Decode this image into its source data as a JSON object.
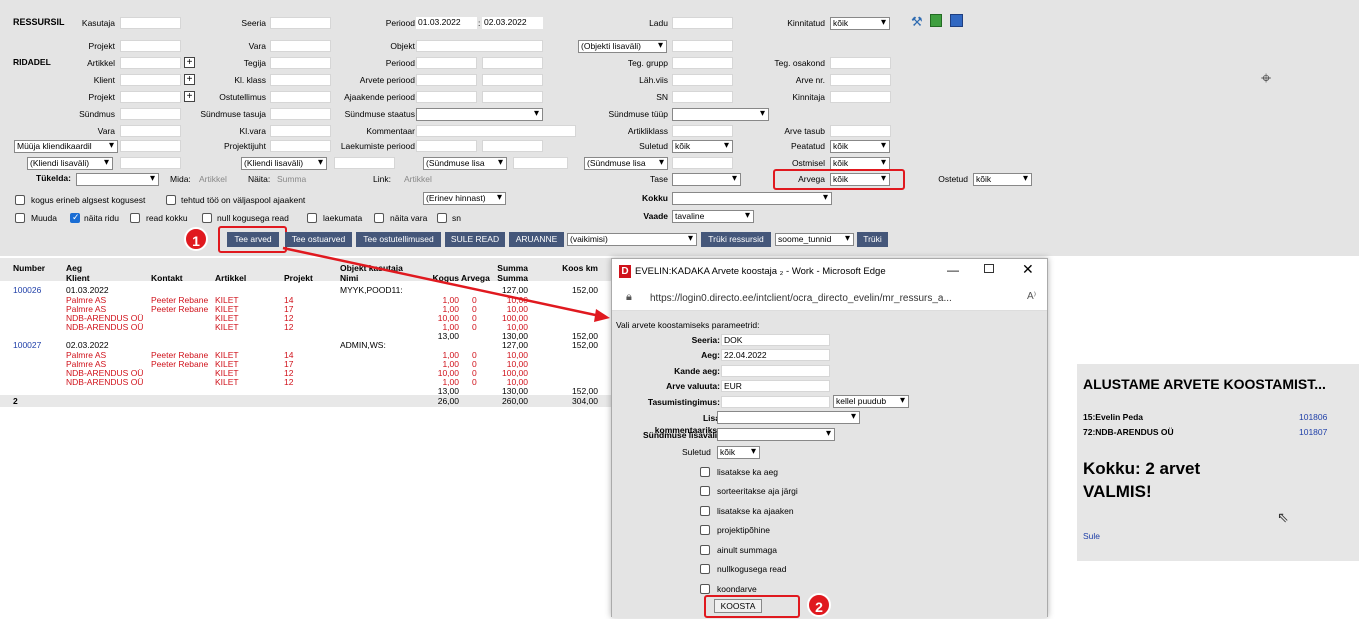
{
  "form": {
    "title": "RESSURSIL",
    "ridadel": "RIDADEL",
    "kasutaja": "Kasutaja",
    "seeria": "Seeria",
    "periood": "Periood",
    "period_from": "01.03.2022",
    "period_sep": ":",
    "period_to": "02.03.2022",
    "ladu": "Ladu",
    "kinnitatud": "Kinnitatud",
    "kinnitatud_val": "kõik",
    "projekt": "Projekt",
    "vara": "Vara",
    "objekt": "Objekt",
    "objekti_lisavali": "(Objekti lisaväli)",
    "artikkel": "Artikkel",
    "tegija": "Tegija",
    "teg_grupp": "Teg. grupp",
    "teg_osakond": "Teg. osakond",
    "klient": "Klient",
    "kl_klass": "Kl. klass",
    "arvete_periood": "Arvete periood",
    "lah_viis": "Läh.viis",
    "arve_nr": "Arve nr.",
    "ostutellimus": "Ostutellimus",
    "ajaakende_periood": "Ajaakende periood",
    "sn": "SN",
    "kinnitaja": "Kinnitaja",
    "syndmus": "Sündmus",
    "syndmuse_tasuja": "Sündmuse tasuja",
    "syndmuse_staatus": "Sündmuse staatus",
    "syndmuse_tyyp": "Sündmuse tüüp",
    "kl_vara": "Kl.vara",
    "kommentaar": "Kommentaar",
    "artikliklass": "Artikliklass",
    "arve_tasub": "Arve tasub",
    "myyja_kliendikaardil": "Müüja kliendikaardil",
    "projektijuht": "Projektijuht",
    "laekumiste_periood": "Laekumiste periood",
    "suletud": "Suletud",
    "suletud_val": "kõik",
    "peatatud": "Peatatud",
    "peatatud_val": "kõik",
    "kliendi_lisavali": "(Kliendi lisaväli)",
    "kliendi_lisavali2": "(Kliendi lisaväli)",
    "syndmuse_lisa": "(Sündmuse lisa",
    "syndmuse_lisa2": "(Sündmuse lisa",
    "ostmisel": "Ostmisel",
    "ostmisel_val": "kõik",
    "tykelda": "Tükelda:",
    "mida": "Mida:",
    "mida_val": "Artikkel",
    "naita": "Näita:",
    "naita_val": "Summa",
    "link": "Link:",
    "link_val": "Artikkel",
    "tase": "Tase",
    "arvega": "Arvega",
    "arvega_val": "kõik",
    "ostetud": "Ostetud",
    "ostetud_val": "kõik",
    "erinev_hinnast": "(Erinev hinnast)",
    "kokku": "Kokku",
    "vaade": "Vaade",
    "vaade_val": "tavaline",
    "cb1": "kogus erineb algsest kogusest",
    "cb2": "tehtud töö on väljaspool ajaakent",
    "cb3": "Muuda",
    "cb4": "näita ridu",
    "cb5": "read kokku",
    "cb6": "null kogusega read",
    "cb7": "laekumata",
    "cb8": "näita vara",
    "cb9": "sn"
  },
  "buttons": {
    "tee_arved": "Tee arved",
    "tee_ostuarved": "Tee ostuarved",
    "tee_ostutellimused": "Tee ostutellimused",
    "sule_read": "SULE READ",
    "aruanne": "ARUANNE",
    "vaikimisi": "(vaikimisi)",
    "tryki_ressursid": "Trüki ressursid",
    "soome_tunnid": "soome_tunnid",
    "tryki": "Trüki"
  },
  "badges": {
    "one": "1",
    "two": "2"
  },
  "table": {
    "headers": {
      "number": "Number",
      "aeg": "Aeg",
      "klient": "Klient",
      "kontakt": "Kontakt",
      "artikkel": "Artikkel",
      "projekt": "Projekt",
      "objekt_kasutaja": "Objekt kasutaja",
      "nimi": "Nimi",
      "kogus": "Kogus",
      "arvega": "Arvega",
      "summa": "Summa",
      "summa2": "Summa",
      "koos_km": "Koos km"
    },
    "groups": [
      {
        "number": "100026",
        "date": "01.03.2022",
        "obj": "MYYK,POOD11:",
        "sum": "127,00",
        "km": "152,00",
        "rows": [
          {
            "klient": "Palmre AS",
            "kontakt": "Peeter Rebane",
            "art": "KILET",
            "proj": "14",
            "kogus": "1,00",
            "arvega": "0",
            "summa": "10,00"
          },
          {
            "klient": "Palmre AS",
            "kontakt": "Peeter Rebane",
            "art": "KILET",
            "proj": "17",
            "kogus": "1,00",
            "arvega": "0",
            "summa": "10,00"
          },
          {
            "klient": "NDB-ARENDUS OÜ",
            "kontakt": "",
            "art": "KILET",
            "proj": "12",
            "kogus": "10,00",
            "arvega": "0",
            "summa": "100,00"
          },
          {
            "klient": "NDB-ARENDUS OÜ",
            "kontakt": "",
            "art": "KILET",
            "proj": "12",
            "kogus": "1,00",
            "arvega": "0",
            "summa": "10,00"
          }
        ],
        "tot_kogus": "13,00",
        "tot_sum": "130,00",
        "tot_km": "152,00"
      },
      {
        "number": "100027",
        "date": "02.03.2022",
        "obj": "ADMIN,WS:",
        "sum": "127,00",
        "km": "152,00",
        "rows": [
          {
            "klient": "Palmre AS",
            "kontakt": "Peeter Rebane",
            "art": "KILET",
            "proj": "14",
            "kogus": "1,00",
            "arvega": "0",
            "summa": "10,00"
          },
          {
            "klient": "Palmre AS",
            "kontakt": "Peeter Rebane",
            "art": "KILET",
            "proj": "17",
            "kogus": "1,00",
            "arvega": "0",
            "summa": "10,00"
          },
          {
            "klient": "NDB-ARENDUS OÜ",
            "kontakt": "",
            "art": "KILET",
            "proj": "12",
            "kogus": "10,00",
            "arvega": "0",
            "summa": "100,00"
          },
          {
            "klient": "NDB-ARENDUS OÜ",
            "kontakt": "",
            "art": "KILET",
            "proj": "12",
            "kogus": "1,00",
            "arvega": "0",
            "summa": "10,00"
          }
        ],
        "tot_kogus": "13,00",
        "tot_sum": "130,00",
        "tot_km": "152,00"
      }
    ],
    "grand": {
      "count": "2",
      "kogus": "26,00",
      "sum": "260,00",
      "km": "304,00"
    }
  },
  "dialog": {
    "title": "EVELIN:KADAKA Arvete koostaja ₂ - Work - Microsoft Edge",
    "url": "https://login0.directo.ee/intclient/ocra_directo_evelin/mr_ressurs_a...",
    "intro": "Vali arvete koostamiseks parameetrid:",
    "seeria": "Seeria:",
    "seeria_val": "DOK",
    "aeg": "Aeg:",
    "aeg_val": "22.04.2022",
    "kande_aeg": "Kande aeg:",
    "valuuta": "Arve valuuta:",
    "valuuta_val": "EUR",
    "tasumistingimus": "Tasumistingimus:",
    "kellel_puudub": "kellel puudub",
    "lisa_kommentaariks": "Lisa kommentaariks:",
    "syndmuse_lisavali": "Sündmuse lisaväli:",
    "suletud": "Suletud",
    "suletud_val": "kõik",
    "checks": [
      "lisatakse ka aeg",
      "sorteeritakse aja järgi",
      "lisatakse ka ajaaken",
      "projektipõhine",
      "ainult summaga",
      "nullkogusega read",
      "koondarve"
    ],
    "koosta": "KOOSTA"
  },
  "result": {
    "title": "ALUSTAME ARVETE KOOSTAMIST...",
    "r1_name": "15:Evelin Peda",
    "r1_num": "101806",
    "r2_name": "72:NDB-ARENDUS OÜ",
    "r2_num": "101807",
    "kokku": "Kokku: 2 arvet",
    "valmis": "VALMIS!",
    "sule": "Sule"
  },
  "colors": {
    "highlight": "#e0191f",
    "button": "#45577a",
    "link": "#1f3fa8",
    "red_text": "#d0121b"
  }
}
